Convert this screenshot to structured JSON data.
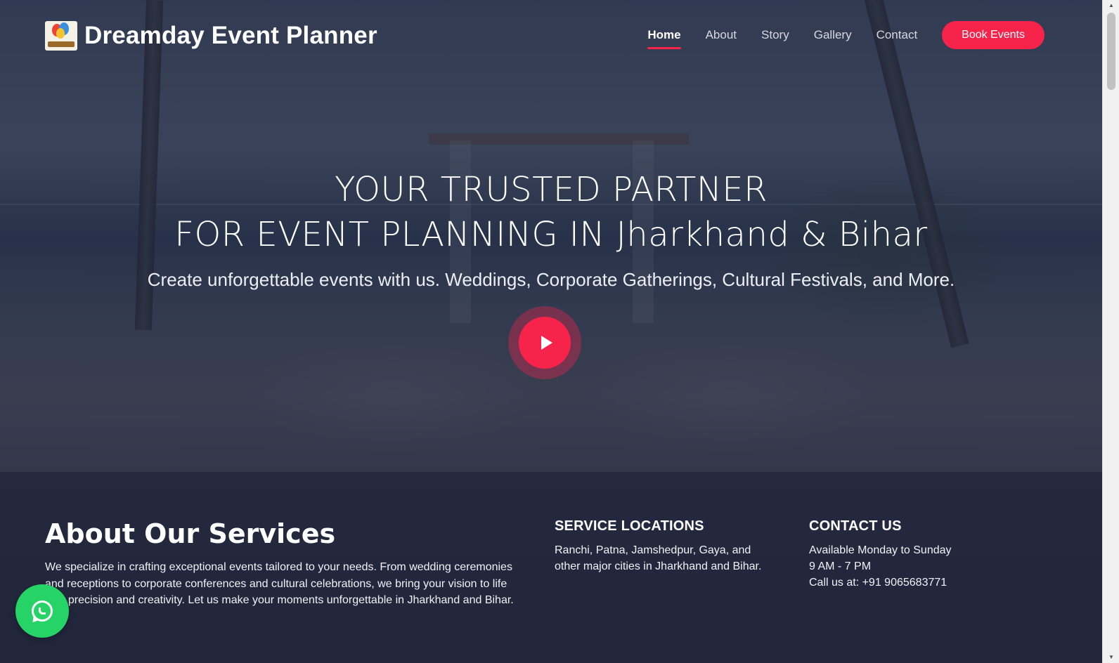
{
  "header": {
    "brand": "Dreamday Event Planner",
    "nav": [
      {
        "label": "Home",
        "active": true
      },
      {
        "label": "About",
        "active": false
      },
      {
        "label": "Story",
        "active": false
      },
      {
        "label": "Gallery",
        "active": false
      },
      {
        "label": "Contact",
        "active": false
      }
    ],
    "cta_label": "Book Events"
  },
  "hero": {
    "title_line1": "YOUR TRUSTED PARTNER",
    "title_line2": "FOR EVENT PLANNING IN Jharkhand & Bihar",
    "subtitle": "Create unforgettable events with us. Weddings, Corporate Gatherings, Cultural Festivals, and More.",
    "play_icon": "play-icon"
  },
  "about": {
    "title": "About Our Services",
    "text": "We specialize in crafting exceptional events tailored to your needs. From wedding ceremonies and receptions to corporate conferences and cultural celebrations, we bring your vision to life with precision and creativity. Let us make your moments unforgettable in Jharkhand and Bihar."
  },
  "service_locations": {
    "title": "SERVICE LOCATIONS",
    "text": "Ranchi, Patna, Jamshedpur, Gaya, and other major cities in Jharkhand and Bihar."
  },
  "contact": {
    "title": "CONTACT US",
    "line1": "Available Monday to Sunday",
    "line2": "9 AM - 7 PM",
    "line3": "Call us at: +91 9065683771"
  },
  "floating": {
    "whatsapp_icon": "whatsapp-icon"
  },
  "colors": {
    "accent": "#f8234a",
    "whatsapp": "#25d366",
    "overlay": "#1c2238"
  }
}
